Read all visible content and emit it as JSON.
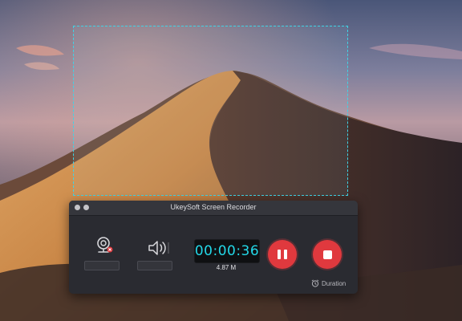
{
  "window": {
    "title": "UkeySoft Screen Recorder"
  },
  "recorder": {
    "camera_icon": "webcam-icon",
    "camera_button_label": "",
    "audio_icon": "speaker-icon",
    "audio_button_label": "",
    "timer": "00:00:36",
    "file_size": "4.87 M",
    "pause_icon": "pause-icon",
    "stop_icon": "stop-icon",
    "duration_label": "Duration",
    "duration_icon": "alarm-clock-icon"
  },
  "colors": {
    "accent": "#23d8e8",
    "record_button": "#e0393e",
    "selection_border": "#3fd3e6",
    "panel_bg": "#2a2b31"
  }
}
